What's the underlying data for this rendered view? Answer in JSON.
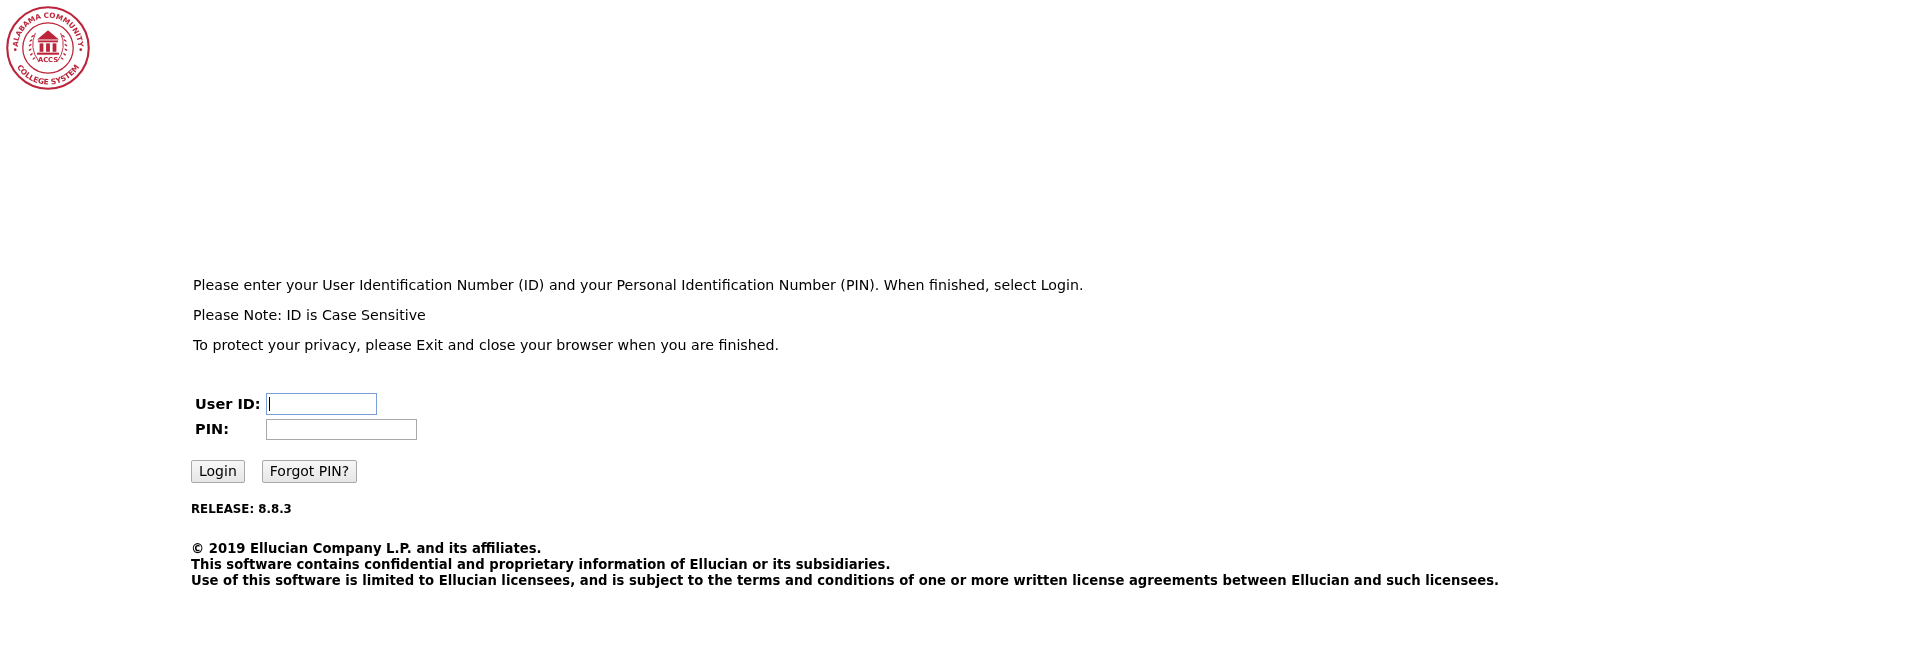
{
  "logo": {
    "top_text": "ALABAMA COMMUNITY",
    "center_text": "ACCS",
    "bottom_text": "COLLEGE SYSTEM"
  },
  "instructions": [
    "Please enter your User Identification Number (ID) and your Personal Identification Number (PIN). When finished, select Login.",
    "Please Note: ID is Case Sensitive",
    "To protect your privacy, please Exit and close your browser when you are finished."
  ],
  "login_form": {
    "fields": [
      {
        "label": "User ID:",
        "focused": true
      },
      {
        "label": "PIN:",
        "focused": false
      }
    ],
    "buttons": [
      "Login",
      "Forgot PIN?"
    ]
  },
  "release": "RELEASE: 8.8.3",
  "footer": [
    "© 2019 Ellucian Company L.P. and its affiliates.",
    "This software contains confidential and proprietary information of Ellucian or its subsidiaries.",
    "Use of this software is limited to Ellucian licensees, and is subject to the terms and conditions of one or more written license agreements between Ellucian and such licensees."
  ]
}
